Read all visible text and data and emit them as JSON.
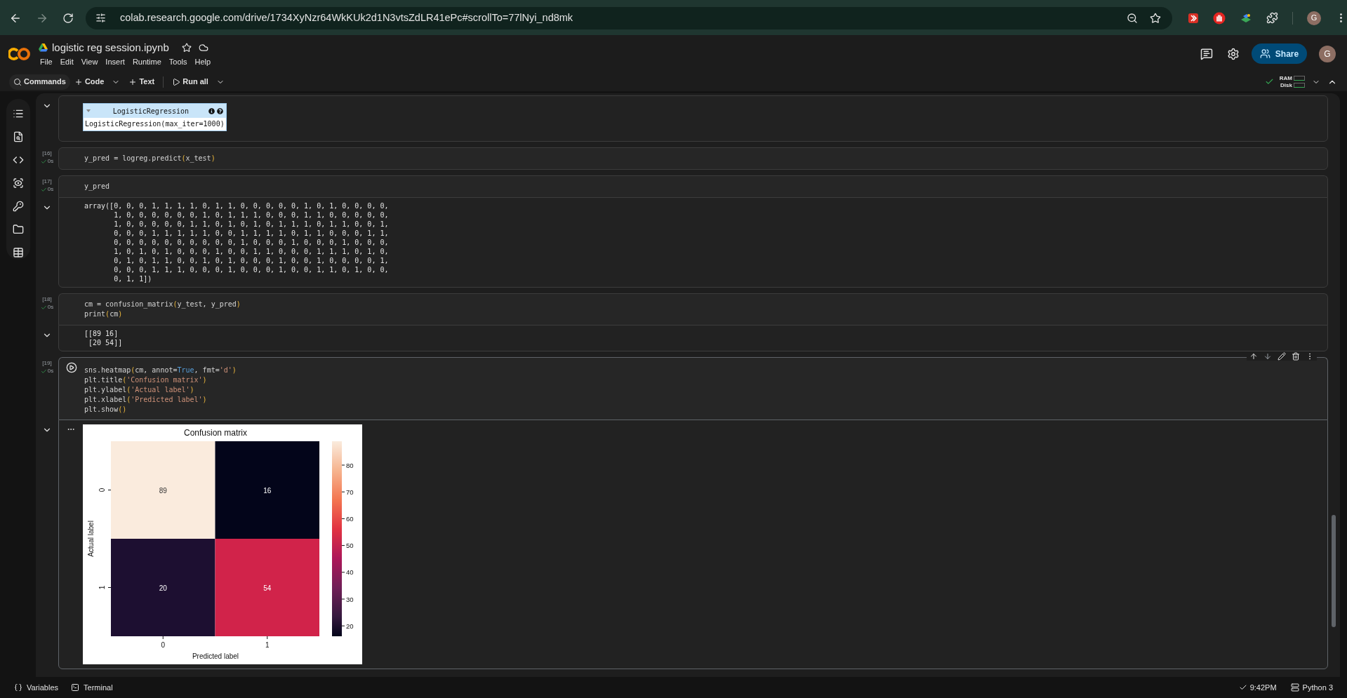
{
  "browser": {
    "url": "colab.research.google.com/drive/1734XyNzr64WkKUk2d1N3vtsZdLR41ePc#scrollTo=77lNyi_nd8mk",
    "profile_initial": "G"
  },
  "notebook": {
    "title": "logistic reg session.ipynb",
    "menu": [
      "File",
      "Edit",
      "View",
      "Insert",
      "Runtime",
      "Tools",
      "Help"
    ],
    "share": "Share",
    "user_initial": "G"
  },
  "toolbar": {
    "items": [
      {
        "kind": "search",
        "label": "Commands",
        "dropdown": false
      },
      {
        "kind": "add",
        "label": "Code",
        "dropdown": true
      },
      {
        "kind": "add",
        "label": "Text",
        "dropdown": false
      },
      {
        "kind": "run",
        "label": "Run all",
        "dropdown": true
      }
    ],
    "resources": [
      "RAM",
      "Disk"
    ]
  },
  "cells": [
    {
      "kind": "output_only",
      "output": {
        "kind": "estimator",
        "name": "LogisticRegression",
        "repr": "LogisticRegression(max_iter=1000)"
      }
    },
    {
      "kind": "code",
      "count": "[16]",
      "time": "0s",
      "selected": false,
      "code": [
        [
          {
            "text": "y_pred = logreg.predict",
            "kind": "plain"
          },
          {
            "text": "(",
            "kind": "paren"
          },
          {
            "text": "x_test",
            "kind": "plain"
          },
          {
            "text": ")",
            "kind": "paren"
          }
        ]
      ]
    },
    {
      "kind": "code",
      "count": "[17]",
      "time": "0s",
      "selected": false,
      "code": [
        [
          {
            "text": "y_pred",
            "kind": "plain"
          }
        ]
      ],
      "output": {
        "kind": "text",
        "lines": [
          "array([0, 0, 0, 1, 1, 1, 1, 0, 1, 1, 0, 0, 0, 0, 0, 1, 0, 1, 0, 0, 0, 0,",
          "       1, 0, 0, 0, 0, 0, 0, 1, 0, 1, 1, 1, 0, 0, 0, 1, 1, 0, 0, 0, 0, 0,",
          "       1, 0, 0, 0, 0, 0, 1, 1, 0, 1, 0, 1, 0, 1, 1, 1, 0, 1, 1, 0, 0, 1,",
          "       0, 0, 0, 1, 1, 1, 1, 1, 0, 0, 1, 1, 1, 1, 0, 1, 1, 0, 0, 0, 1, 1,",
          "       0, 0, 0, 0, 0, 0, 0, 0, 0, 0, 1, 0, 0, 0, 1, 0, 0, 0, 1, 0, 0, 0,",
          "       1, 0, 1, 0, 1, 0, 0, 0, 1, 0, 0, 1, 1, 0, 0, 0, 1, 1, 1, 0, 1, 0,",
          "       0, 1, 0, 1, 1, 0, 0, 1, 0, 1, 0, 0, 0, 1, 0, 0, 1, 0, 0, 0, 0, 1,",
          "       0, 0, 0, 1, 1, 1, 0, 0, 0, 1, 0, 0, 0, 1, 0, 0, 1, 1, 0, 1, 0, 0,",
          "       0, 1, 1])"
        ]
      }
    },
    {
      "kind": "code",
      "count": "[18]",
      "time": "0s",
      "selected": false,
      "code": [
        [
          {
            "text": "cm = confusion_matrix",
            "kind": "plain"
          },
          {
            "text": "(",
            "kind": "paren"
          },
          {
            "text": "y_test, y_pred",
            "kind": "plain"
          },
          {
            "text": ")",
            "kind": "paren"
          }
        ],
        [
          {
            "text": "print",
            "kind": "plain"
          },
          {
            "text": "(",
            "kind": "paren"
          },
          {
            "text": "cm",
            "kind": "plain"
          },
          {
            "text": ")",
            "kind": "paren"
          }
        ]
      ],
      "output": {
        "kind": "text",
        "lines": [
          "[[89 16]",
          " [20 54]]"
        ]
      }
    },
    {
      "kind": "code",
      "count": "[19]",
      "time": "0s",
      "selected": true,
      "code": [
        [
          {
            "text": "sns.heatmap",
            "kind": "plain"
          },
          {
            "text": "(",
            "kind": "paren"
          },
          {
            "text": "cm, annot=",
            "kind": "plain"
          },
          {
            "text": "True",
            "kind": "keyword"
          },
          {
            "text": ", fmt=",
            "kind": "plain"
          },
          {
            "text": "'d'",
            "kind": "string"
          },
          {
            "text": ")",
            "kind": "paren"
          }
        ],
        [
          {
            "text": "plt.title",
            "kind": "plain"
          },
          {
            "text": "(",
            "kind": "paren"
          },
          {
            "text": "'Confusion matrix'",
            "kind": "string"
          },
          {
            "text": ")",
            "kind": "paren"
          }
        ],
        [
          {
            "text": "plt.ylabel",
            "kind": "plain"
          },
          {
            "text": "(",
            "kind": "paren"
          },
          {
            "text": "'Actual label'",
            "kind": "string"
          },
          {
            "text": ")",
            "kind": "paren"
          }
        ],
        [
          {
            "text": "plt.xlabel",
            "kind": "plain"
          },
          {
            "text": "(",
            "kind": "paren"
          },
          {
            "text": "'Predicted label'",
            "kind": "string"
          },
          {
            "text": ")",
            "kind": "paren"
          }
        ],
        [
          {
            "text": "plt.show",
            "kind": "plain"
          },
          {
            "text": "()",
            "kind": "paren"
          }
        ]
      ],
      "output": {
        "kind": "heatmap",
        "title": "Confusion matrix",
        "xlabel": "Predicted label",
        "ylabel": "Actual label",
        "xticks": [
          "0",
          "1"
        ],
        "yticks": [
          "0",
          "1"
        ],
        "rows": [
          [
            {
              "value": "89",
              "color": "#faebdd"
            },
            {
              "value": "16",
              "color": "#03051a"
            }
          ],
          [
            {
              "value": "20",
              "color": "#1d0f31"
            },
            {
              "value": "54",
              "color": "#d1234a"
            }
          ]
        ],
        "colorbar_ticks": [
          "80",
          "70",
          "60",
          "50",
          "40",
          "30",
          "20"
        ]
      }
    }
  ],
  "status_bar": {
    "items": [
      {
        "kind": "variables",
        "label": "Variables"
      },
      {
        "kind": "terminal",
        "label": "Terminal"
      }
    ],
    "time": "9:42PM",
    "runtime": "Python 3"
  }
}
